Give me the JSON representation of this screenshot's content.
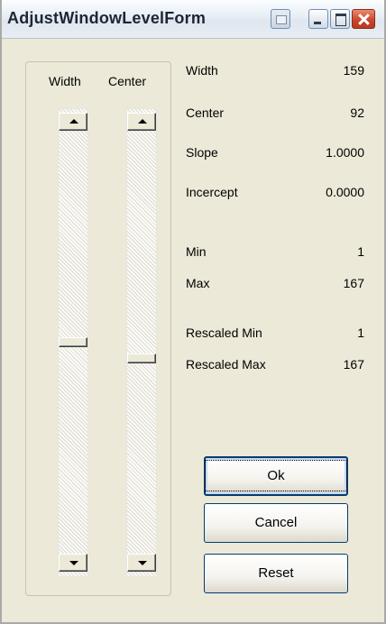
{
  "window": {
    "title": "AdjustWindowLevelForm"
  },
  "sliders": {
    "width_label": "Width",
    "center_label": "Center",
    "width_position": 0.5,
    "center_position": 0.54
  },
  "info": {
    "width": {
      "label": "Width",
      "value": "159"
    },
    "center": {
      "label": "Center",
      "value": "92"
    },
    "slope": {
      "label": "Slope",
      "value": "1.0000"
    },
    "intercept": {
      "label": "Incercept",
      "value": "0.0000"
    },
    "min": {
      "label": "Min",
      "value": "1"
    },
    "max": {
      "label": "Max",
      "value": "167"
    },
    "rescaled_min": {
      "label": "Rescaled Min",
      "value": "1"
    },
    "rescaled_max": {
      "label": "Rescaled Max",
      "value": "167"
    }
  },
  "buttons": {
    "ok": "Ok",
    "cancel": "Cancel",
    "reset": "Reset"
  }
}
